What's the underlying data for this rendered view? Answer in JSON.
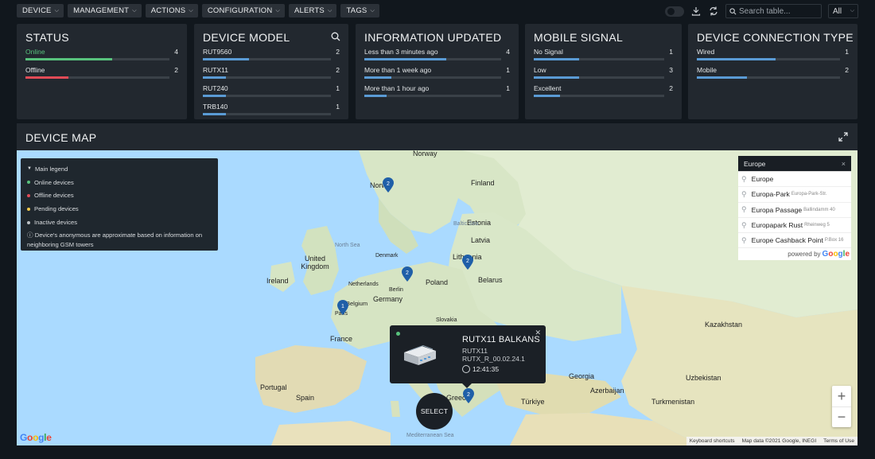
{
  "toolbar": {
    "buttons": [
      "Device",
      "Management",
      "Actions",
      "Configuration",
      "Alerts",
      "Tags"
    ],
    "search_placeholder": "Search table...",
    "filter_value": "All"
  },
  "cards": {
    "status": {
      "title": "Status",
      "rows": [
        {
          "label": "Online",
          "count": "4",
          "fraction": 0.6,
          "color": "#58c27d",
          "label_color": "#58c27d"
        },
        {
          "label": "Offline",
          "count": "2",
          "fraction": 0.3,
          "color": "#e14b57"
        }
      ]
    },
    "device_model": {
      "title": "Device Model",
      "rows": [
        {
          "label": "RUT9560",
          "count": "2",
          "fraction": 0.36
        },
        {
          "label": "RUTX11",
          "count": "2",
          "fraction": 0.18
        },
        {
          "label": "RUT240",
          "count": "1",
          "fraction": 0.18
        },
        {
          "label": "TRB140",
          "count": "1",
          "fraction": 0.18
        }
      ]
    },
    "information_updated": {
      "title": "Information Updated",
      "rows": [
        {
          "label": "Less than 3 minutes ago",
          "count": "4",
          "fraction": 0.6
        },
        {
          "label": "More than 1 week ago",
          "count": "1",
          "fraction": 0.2
        },
        {
          "label": "More than 1 hour ago",
          "count": "1",
          "fraction": 0.16
        }
      ]
    },
    "mobile_signal": {
      "title": "Mobile Signal",
      "rows": [
        {
          "label": "No Signal",
          "count": "1",
          "fraction": 0.35
        },
        {
          "label": "Low",
          "count": "3",
          "fraction": 0.35
        },
        {
          "label": "Excellent",
          "count": "2",
          "fraction": 0.2
        }
      ]
    },
    "connection_type": {
      "title": "Device Connection Type",
      "rows": [
        {
          "label": "Wired",
          "count": "1",
          "fraction": 0.55
        },
        {
          "label": "Mobile",
          "count": "2",
          "fraction": 0.35
        }
      ]
    }
  },
  "map": {
    "title": "Device Map",
    "legend": {
      "header": "Main legend",
      "items": [
        {
          "label": "Online devices",
          "color": "#58c27d"
        },
        {
          "label": "Offline devices",
          "color": "#e14b57"
        },
        {
          "label": "Pending devices",
          "color": "#f2c94c"
        },
        {
          "label": "Inactive devices",
          "color": "#b9bec3"
        }
      ],
      "note": "Device's anonymous are approximate based on information on neighboring GSM towers"
    },
    "search": {
      "value": "Europe",
      "suggestions": [
        {
          "main": "Europe",
          "sub": ""
        },
        {
          "main": "Europa-Park",
          "sub": "Europa-Park-Str."
        },
        {
          "main": "Europa Passage",
          "sub": "Ballindamm 40"
        },
        {
          "main": "Europapark Rust",
          "sub": "Rheinweg 5"
        },
        {
          "main": "Europe Cashback Point",
          "sub": "P.Box 16"
        }
      ],
      "powered_by": "powered by"
    },
    "markers": [
      {
        "count": "2"
      },
      {
        "count": "2"
      },
      {
        "count": "2"
      },
      {
        "count": "1"
      },
      {
        "count": "2"
      }
    ],
    "popup": {
      "name": "RUTX11 Balkans",
      "model": "RUTX11",
      "firmware": "RUTX_R_00.02.24.1",
      "time": "12:41:35"
    },
    "select_label": "SELECT",
    "places": [
      "Norway",
      "Finland",
      "Norw",
      "Estonia",
      "Baltic Sea",
      "Latvia",
      "North Sea",
      "Denmark",
      "Lithuania",
      "United Kingdom",
      "Ireland",
      "Netherlands",
      "Berlin",
      "Poland",
      "Belarus",
      "Germany",
      "Belgium",
      "Paris",
      "Slovakia",
      "France",
      "Kazakhstan",
      "Georgia",
      "Uzbekistan",
      "Portugal",
      "Spain",
      "Greec",
      "Azerbaijan",
      "Türkiye",
      "Turkmenistan",
      "Mediterranean Sea"
    ],
    "footer": {
      "keyboard": "Keyboard shortcuts",
      "map_data": "Map data ©2021 Google, INEGI",
      "terms": "Terms of Use"
    }
  }
}
